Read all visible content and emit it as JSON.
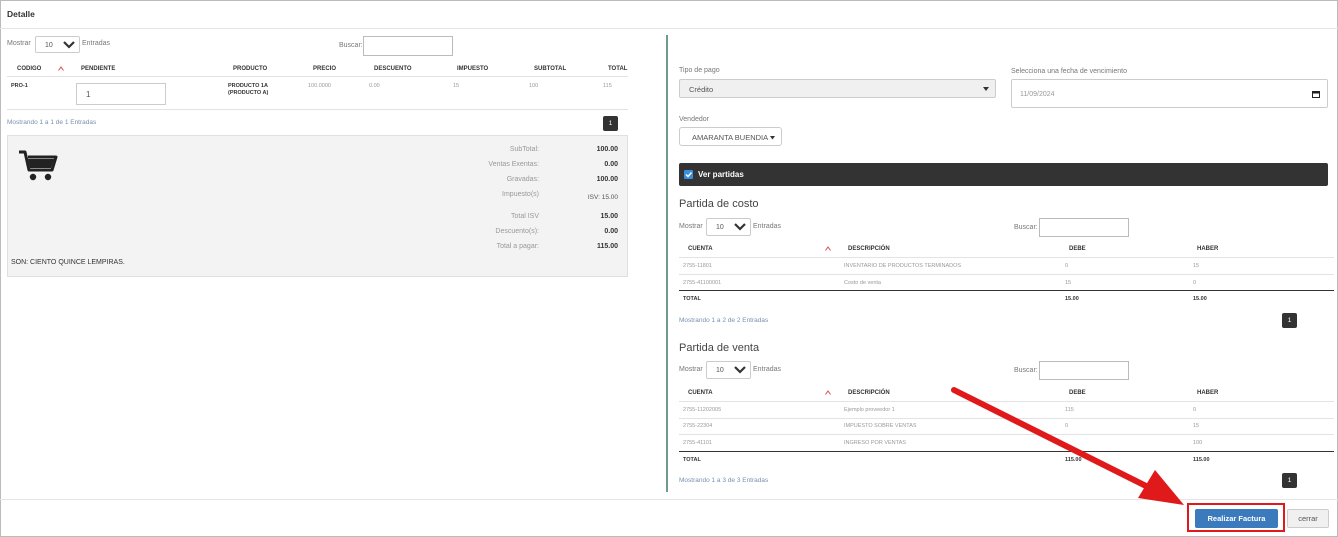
{
  "modal": {
    "title": "Detalle"
  },
  "left": {
    "show_label": "Mostrar",
    "show_value": "10",
    "entries_label": "Entradas",
    "search_label": "Buscar:",
    "columns": [
      "CODIGO",
      "PENDIENTE",
      "PRODUCTO",
      "PRECIO",
      "DESCUENTO",
      "IMPUESTO",
      "SUBTOTAL",
      "TOTAL"
    ],
    "row": {
      "codigo": "PRO-1",
      "pendiente": "1",
      "producto_line1": "PRODUCTO 1A",
      "producto_line2": "(PRODUCTO A)",
      "precio": "100.0000",
      "descuento": "0.00",
      "impuesto": "15",
      "subtotal": "100",
      "total": "115"
    },
    "info": "Mostrando 1 a 1 de 1 Entradas",
    "page": "1",
    "summary": {
      "subtotal_label": "SubTotal:",
      "subtotal": "100.00",
      "exentas_label": "Ventas Exentas:",
      "exentas": "0.00",
      "gravadas_label": "Gravadas:",
      "gravadas": "100.00",
      "impuestos_label": "Impuesto(s)",
      "impuestos": "ISV: 15.00",
      "total_isv_label": "Total ISV",
      "total_isv": "15.00",
      "descuentos_label": "Descuento(s):",
      "descuentos": "0.00",
      "total_pagar_label": "Total a pagar:",
      "total_pagar": "115.00",
      "son": "SON: CIENTO QUINCE LEMPIRAS."
    }
  },
  "right": {
    "tipo_pago_label": "Tipo de pago",
    "tipo_pago_value": "Crédito",
    "fecha_label": "Selecciona una fecha de vencimiento",
    "fecha_value": "11/09/2024",
    "vendedor_label": "Vendedor",
    "vendedor_value": "AMARANTA BUENDIA",
    "ver_partidas": "Ver partidas",
    "costo": {
      "title": "Partida de costo",
      "show_label": "Mostrar",
      "show_value": "10",
      "entries_label": "Entradas",
      "search_label": "Buscar:",
      "columns": [
        "CUENTA",
        "DESCRIPCIÓN",
        "DEBE",
        "HABER"
      ],
      "rows": [
        {
          "cuenta": "2755-11801",
          "descripcion": "INVENTARIO DE PRODUCTOS TERMINADOS",
          "debe": "0",
          "haber": "15"
        },
        {
          "cuenta": "2755-41100001",
          "descripcion": "Costo de venta",
          "debe": "15",
          "haber": "0"
        }
      ],
      "total_label": "TOTAL",
      "total_debe": "15.00",
      "total_haber": "15.00",
      "info": "Mostrando 1 a 2 de 2 Entradas",
      "page": "1"
    },
    "venta": {
      "title": "Partida de venta",
      "show_label": "Mostrar",
      "show_value": "10",
      "entries_label": "Entradas",
      "search_label": "Buscar:",
      "columns": [
        "CUENTA",
        "DESCRIPCIÓN",
        "DEBE",
        "HABER"
      ],
      "rows": [
        {
          "cuenta": "2755-11202005",
          "descripcion": "Ejemplo proveedor 1",
          "debe": "115",
          "haber": "0"
        },
        {
          "cuenta": "2755-22304",
          "descripcion": "IMPUESTO SOBRE VENTAS",
          "debe": "0",
          "haber": "15"
        },
        {
          "cuenta": "2755-41101",
          "descripcion": "INGRESO POR VENTAS",
          "debe": "",
          "haber": "100"
        }
      ],
      "total_label": "TOTAL",
      "total_debe": "115.00",
      "total_haber": "115.00",
      "info": "Mostrando 1 a 3 de 3 Entradas",
      "page": "1"
    }
  },
  "footer": {
    "submit_label": "Realizar Factura",
    "close_label": "cerrar"
  },
  "colors": {
    "primary": "#3a7abd",
    "annotation_red": "#e0191b",
    "dark_bar": "#333333"
  }
}
